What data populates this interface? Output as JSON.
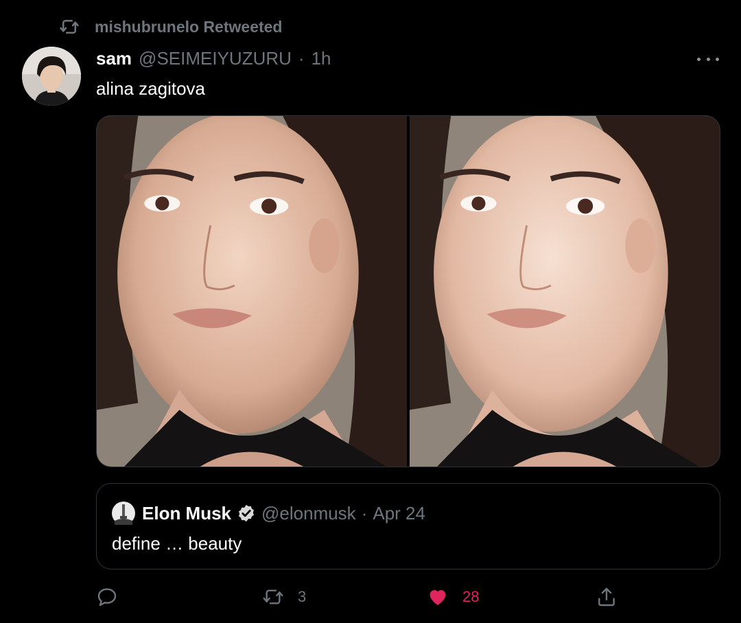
{
  "retweet_context": {
    "label": "mishubrunelo Retweeted",
    "icon": "retweet-icon"
  },
  "tweet": {
    "author_name": "sam",
    "handle": "@SEIMEIYUZURU",
    "separator": "·",
    "time": "1h",
    "text": "alina zagitova",
    "more_icon": "more-dots-icon",
    "media_count": 2
  },
  "quoted_tweet": {
    "author_name": "Elon Musk",
    "verified": true,
    "handle": "@elonmusk",
    "separator": "·",
    "date": "Apr 24",
    "text": "define … beauty"
  },
  "actions": {
    "reply": {
      "icon": "reply-icon",
      "count": ""
    },
    "retweet": {
      "icon": "retweet-icon",
      "count": "3"
    },
    "like": {
      "icon": "heart-icon",
      "count": "28",
      "liked": true
    },
    "share": {
      "icon": "share-icon"
    }
  },
  "colors": {
    "background": "#000000",
    "text_primary": "#ffffff",
    "text_secondary": "#6e767d",
    "border": "#2f3336",
    "like": "#e0245e"
  }
}
